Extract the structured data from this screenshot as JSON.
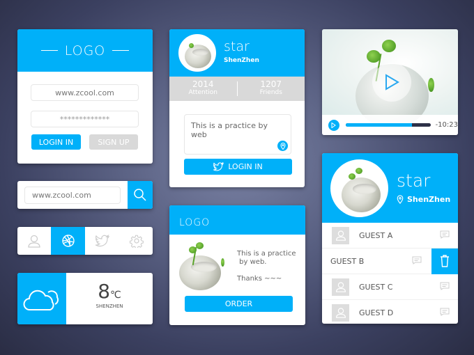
{
  "login_card": {
    "logo": "LOGO",
    "username": "www.zcool.com",
    "password": "*************",
    "login_label": "LOGIN IN",
    "signup_label": "SIGN UP"
  },
  "search": {
    "value": "www.zcool.com",
    "icon": "search-icon"
  },
  "icon_tabs": {
    "items": [
      {
        "icon": "user-icon"
      },
      {
        "icon": "dribbble-icon",
        "active": true
      },
      {
        "icon": "twitter-icon"
      },
      {
        "icon": "gear-icon"
      }
    ]
  },
  "weather": {
    "temp": "8",
    "unit": "℃",
    "city": "SHENZHEN",
    "icon": "cloud-icon"
  },
  "profile": {
    "name": "star",
    "city": "ShenZhen",
    "stats": [
      {
        "value": "2014",
        "label": "Attention"
      },
      {
        "value": "1207",
        "label": "Friends"
      }
    ],
    "message": "This is a practice by web",
    "login_label": "LOGIN IN"
  },
  "product": {
    "logo": "LOGO",
    "text1": "This is a practice",
    "text2": " by web.",
    "text3": "Thanks ~~~",
    "order_label": "ORDER"
  },
  "video": {
    "time": "-10:23",
    "progress": 0.78
  },
  "friends": {
    "name": "star",
    "city": "ShenZhen",
    "guests": [
      "GUEST A",
      "GUEST B",
      "GUEST C",
      "GUEST D"
    ]
  },
  "colors": {
    "accent": "#00b0f9",
    "gray": "#d9d9d9"
  }
}
